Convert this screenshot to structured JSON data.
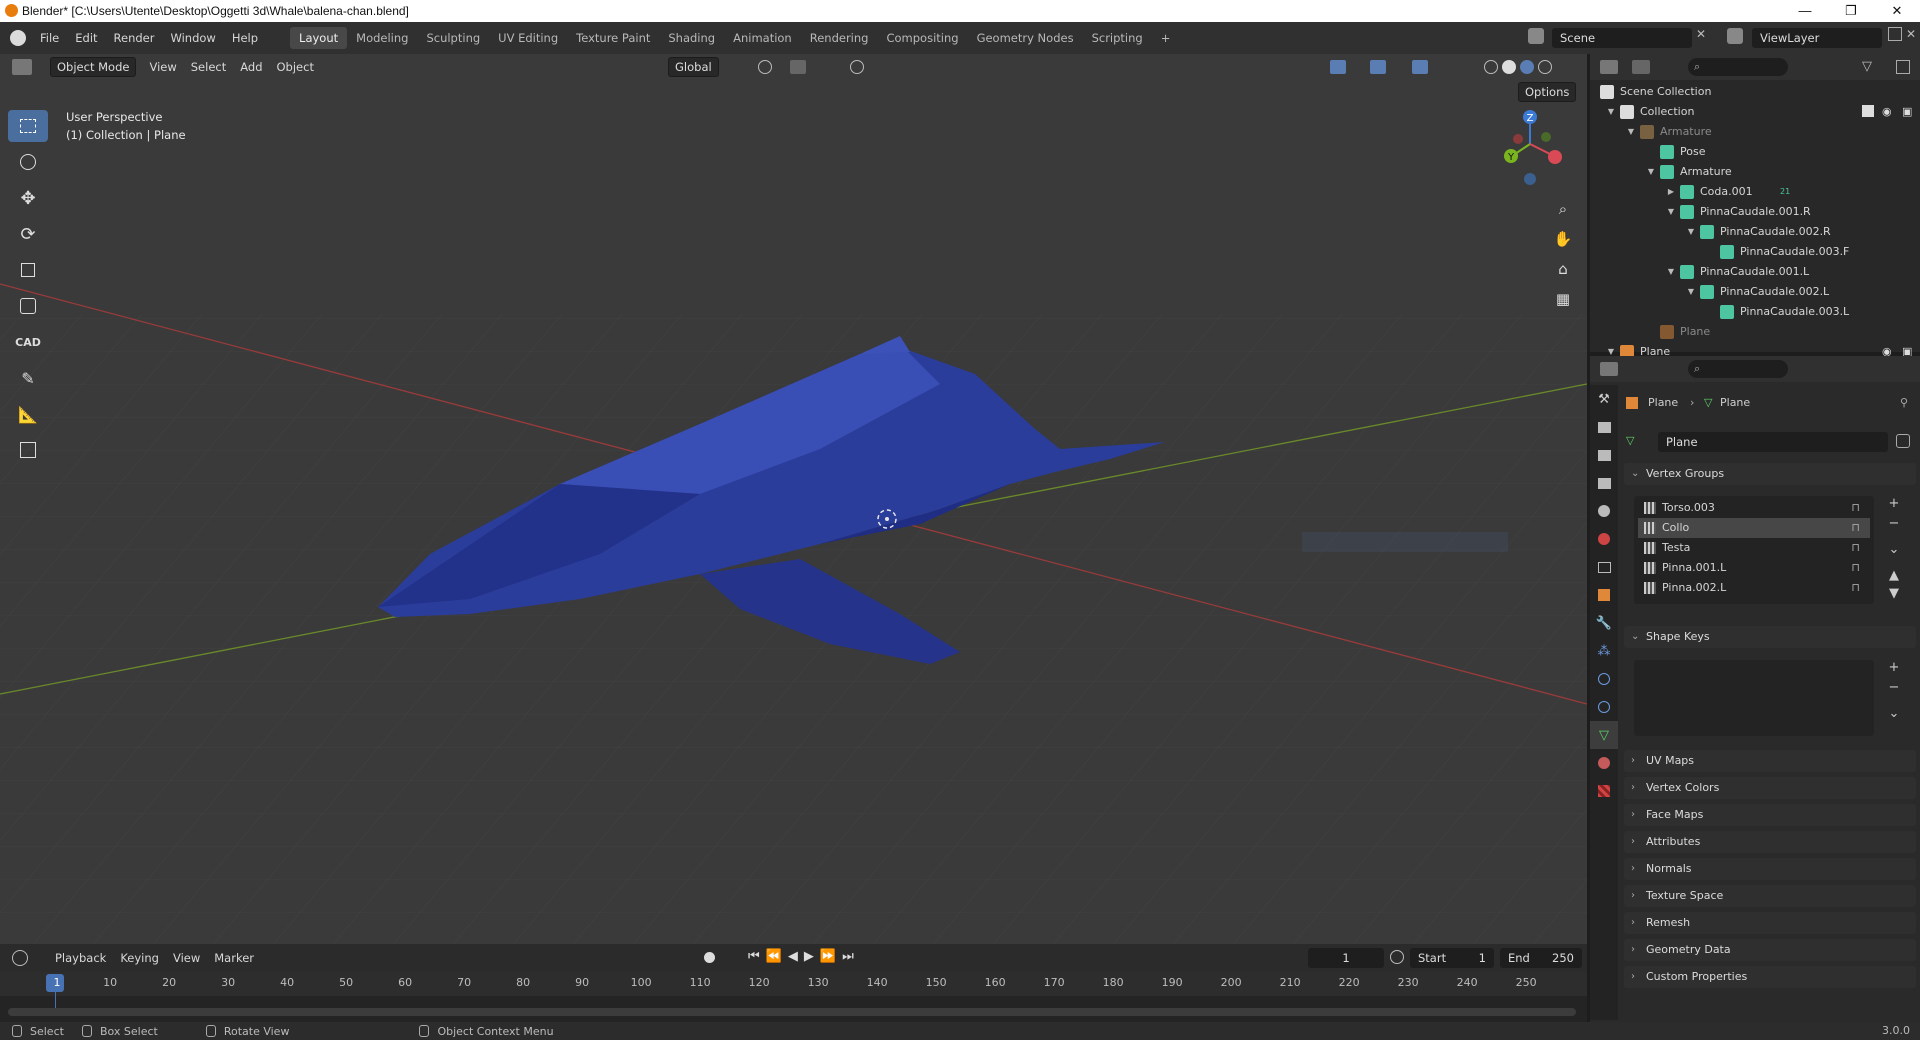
{
  "window": {
    "title": "Blender* [C:\\Users\\Utente\\Desktop\\Oggetti 3d\\Whale\\balena-chan.blend]",
    "buttons": [
      "—",
      "❐",
      "✕"
    ]
  },
  "menu": [
    "File",
    "Edit",
    "Render",
    "Window",
    "Help"
  ],
  "workspaces": [
    "Layout",
    "Modeling",
    "Sculpting",
    "UV Editing",
    "Texture Paint",
    "Shading",
    "Animation",
    "Rendering",
    "Compositing",
    "Geometry Nodes",
    "Scripting",
    "+"
  ],
  "active_workspace": "Layout",
  "scene": "Scene",
  "view_layer": "ViewLayer",
  "viewport": {
    "mode": "Object Mode",
    "menus": [
      "View",
      "Select",
      "Add",
      "Object"
    ],
    "orientation": "Global",
    "options": "Options",
    "perspective": "User Perspective",
    "collection_info": "(1) Collection | Plane",
    "gizmo_axes": [
      "Z",
      "Y",
      "X"
    ],
    "cad_label": "CAD"
  },
  "outliner": {
    "rows": [
      {
        "label": "Scene Collection",
        "indent": 0,
        "icon": "scene-collection-icon"
      },
      {
        "label": "Collection",
        "indent": 1,
        "icon": "collection-icon"
      },
      {
        "label": "Armature",
        "indent": 2,
        "icon": "armature-icon",
        "dim": true
      },
      {
        "label": "Pose",
        "indent": 3,
        "icon": "pose-icon"
      },
      {
        "label": "Armature",
        "indent": 3,
        "icon": "armature-data-icon"
      },
      {
        "label": "Coda.001",
        "indent": 4,
        "icon": "bone-icon",
        "badge": "21"
      },
      {
        "label": "PinnaCaudale.001.R",
        "indent": 4,
        "icon": "bone-icon"
      },
      {
        "label": "PinnaCaudale.002.R",
        "indent": 5,
        "icon": "bone-icon"
      },
      {
        "label": "PinnaCaudale.003.F",
        "indent": 6,
        "icon": "bone-icon"
      },
      {
        "label": "PinnaCaudale.001.L",
        "indent": 4,
        "icon": "bone-icon"
      },
      {
        "label": "PinnaCaudale.002.L",
        "indent": 5,
        "icon": "bone-icon"
      },
      {
        "label": "PinnaCaudale.003.L",
        "indent": 6,
        "icon": "bone-icon"
      },
      {
        "label": "Plane",
        "indent": 3,
        "icon": "mesh-icon",
        "dim": true
      },
      {
        "label": "Plane",
        "indent": 1,
        "icon": "mesh-object-icon"
      }
    ]
  },
  "properties": {
    "breadcrumb": [
      "Plane",
      "Plane"
    ],
    "mesh_name": "Plane",
    "vertex_groups_title": "Vertex Groups",
    "vertex_groups": [
      "Torso.003",
      "Collo",
      "Testa",
      "Pinna.001.L",
      "Pinna.002.L"
    ],
    "selected_group": "Collo",
    "shape_keys_title": "Shape Keys",
    "panels": [
      "UV Maps",
      "Vertex Colors",
      "Face Maps",
      "Attributes",
      "Normals",
      "Texture Space",
      "Remesh",
      "Geometry Data",
      "Custom Properties"
    ]
  },
  "timeline": {
    "menus": [
      "Playback",
      "Keying",
      "View",
      "Marker"
    ],
    "current_frame": "1",
    "start_label": "Start",
    "start": "1",
    "end_label": "End",
    "end": "250",
    "ticks": [
      "1",
      "10",
      "20",
      "30",
      "40",
      "50",
      "60",
      "70",
      "80",
      "90",
      "100",
      "110",
      "120",
      "130",
      "140",
      "150",
      "160",
      "170",
      "180",
      "190",
      "200",
      "210",
      "220",
      "230",
      "240",
      "250"
    ]
  },
  "status": {
    "items": [
      "Select",
      "Box Select",
      "Rotate View",
      "Object Context Menu"
    ],
    "version": "3.0.0"
  },
  "colors": {
    "accent": "#4a6f9f",
    "whale": "#2a3a9a",
    "x_axis": "#9a3a3a",
    "y_axis": "#6a8a2a"
  }
}
